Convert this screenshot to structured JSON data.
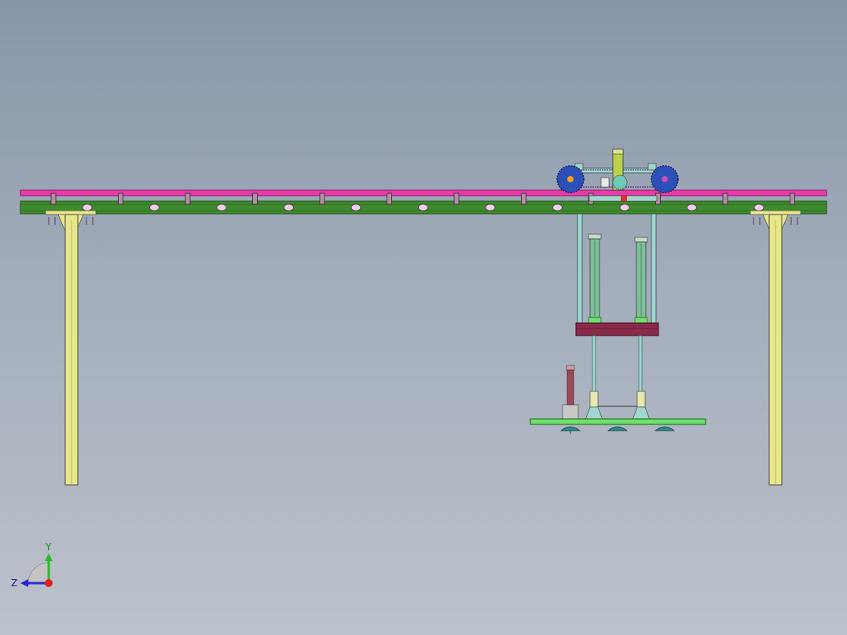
{
  "view": {
    "triad": {
      "y_label": "Y",
      "z_label": "Z"
    }
  },
  "colors": {
    "background_top": "#8796a8",
    "background_bottom": "#bcc2cb",
    "top_rail": "#e83aa8",
    "main_beam": "#3f8a2e",
    "beam_edge": "#2a6b1e",
    "column": "#e8e88a",
    "wheel": "#2d4fb8",
    "motor": "#b9d24a",
    "cylinder": "#7fbf9a",
    "guide_rod": "#9fd6cf",
    "carriage_plate": "#8a2a4a",
    "gripper_bar": "#6ee36a",
    "bolts": "#5a3a5a",
    "small_cylinder": "#9a4a5a"
  },
  "icons": {
    "triad": "coordinate-triad-icon"
  }
}
